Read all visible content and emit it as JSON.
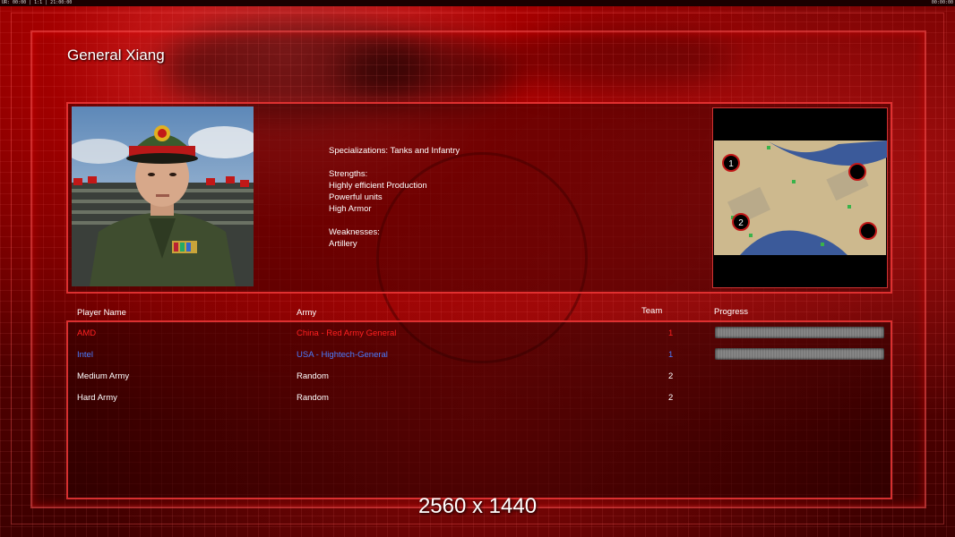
{
  "topbar": {
    "left_text": "UR: 00:00 | 1:1 | 21:00:00",
    "right_text": "00:00:00"
  },
  "general": {
    "name": "General Xiang",
    "specializations": "Specializations: Tanks and Infantry",
    "strengths_label": "Strengths:",
    "strengths": [
      "Highly efficient Production",
      "Powerful units",
      "High Armor"
    ],
    "weaknesses_label": "Weaknesses:",
    "weaknesses": [
      "Artillery"
    ]
  },
  "minimap": {
    "start_positions": [
      "1",
      "2"
    ]
  },
  "roster": {
    "headers": {
      "player": "Player Name",
      "army": "Army",
      "team": "Team",
      "progress": "Progress"
    },
    "players": [
      {
        "name": "AMD",
        "army": "China - Red Army General",
        "team": "1",
        "color": "#ff2020",
        "progress": 1.0
      },
      {
        "name": "Intel",
        "army": "USA - Hightech-General",
        "team": "1",
        "color": "#4a7dff",
        "progress": 1.0
      },
      {
        "name": "Medium Army",
        "army": "Random",
        "team": "2",
        "color": "#ffffff",
        "progress": null
      },
      {
        "name": "Hard Army",
        "army": "Random",
        "team": "2",
        "color": "#ffffff",
        "progress": null
      }
    ]
  },
  "overlay": {
    "resolution": "2560 x 1440"
  },
  "colors": {
    "accent": "#ff3c3c",
    "background": "#6b0000"
  }
}
